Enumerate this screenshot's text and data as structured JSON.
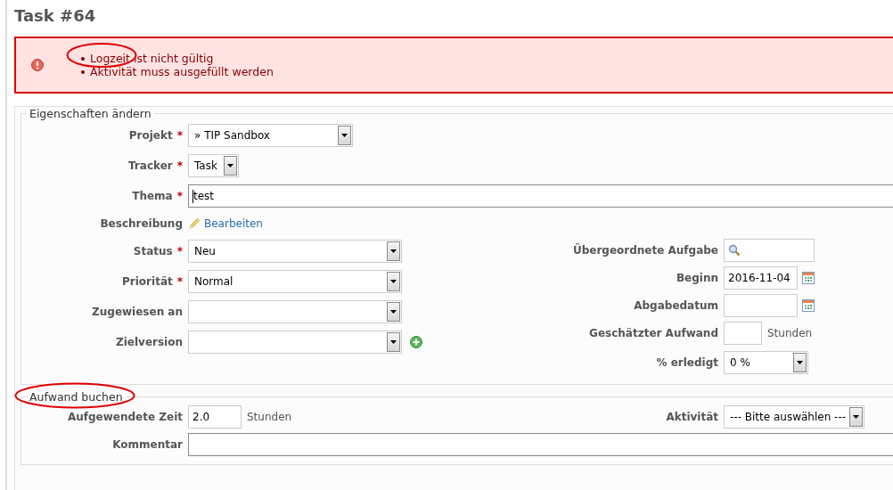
{
  "title": "Task #64",
  "errors": [
    {
      "text": "Logzeit ist nicht gültig",
      "highlighted": true
    },
    {
      "text": "Aktivität muss ausgefüllt werden",
      "highlighted": false
    }
  ],
  "properties": {
    "legend": "Eigenschaften ändern",
    "rows": [
      {
        "label": "Projekt",
        "marker": "*",
        "kind": "select",
        "value": "» TIP Sandbox"
      },
      {
        "label": "Tracker",
        "marker": "*",
        "kind": "select",
        "value": "Task"
      },
      {
        "label": "Thema",
        "marker": "*",
        "kind": "text",
        "value": "test"
      },
      {
        "label": "Beschreibung",
        "kind": "link",
        "value": "Bearbeiten"
      }
    ],
    "left": [
      {
        "label": "Status",
        "marker": "*",
        "kind": "select",
        "value": "Neu"
      },
      {
        "label": "Priorität",
        "marker": "*",
        "kind": "select",
        "value": "Normal"
      },
      {
        "label": "Zugewiesen an",
        "kind": "select"
      },
      {
        "label": "Zielversion",
        "kind": "select-add"
      }
    ],
    "right": [
      {
        "label": "Übergeordnete Aufgabe",
        "kind": "search"
      },
      {
        "label": "Beginn",
        "kind": "date",
        "value": "2016-11-04"
      },
      {
        "label": "Abgabedatum",
        "kind": "date"
      },
      {
        "label": "Geschätzter Aufwand",
        "kind": "number",
        "unit": "Stunden"
      },
      {
        "label": "% erledigt",
        "kind": "select",
        "value": "0 %"
      }
    ]
  },
  "time_entry": {
    "legend": "Aufwand buchen",
    "highlighted": true,
    "left": {
      "label": "Aufgewendete Zeit",
      "kind": "number",
      "value": "2.0",
      "unit": "Stunden"
    },
    "right": {
      "label": "Aktivität",
      "kind": "select",
      "value": "--- Bitte auswählen ---"
    },
    "rows": [
      {
        "label": "Kommentar",
        "kind": "text"
      }
    ]
  }
}
